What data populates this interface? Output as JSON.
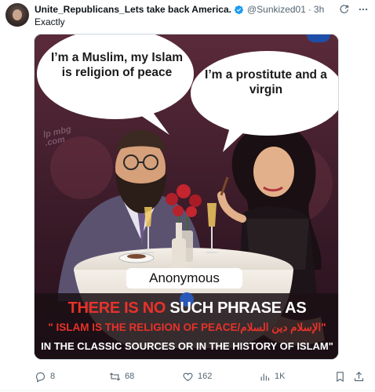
{
  "post": {
    "display_name": "Unite_Republicans_Lets take back America.",
    "handle": "@Sunkized01",
    "separator": "·",
    "time": "3h",
    "text": "Exactly"
  },
  "media": {
    "bubble_left": "I’m a Muslim, my Islam is religion of peace",
    "bubble_right": "I’m a prostitute and a virgin",
    "watermark": "lp mbg .com",
    "label": "Anonymous",
    "caption": {
      "line1_red": "THERE IS NO",
      "line1_white": "SUCH PHRASE AS",
      "line2": "\" ISLAM IS THE RELIGION OF PEACE/الإسلام دين السلام\"",
      "line3": "IN THE CLASSIC SOURCES OR IN THE HISTORY OF ISLAM\""
    }
  },
  "actions": {
    "replies": "8",
    "reposts": "68",
    "likes": "162",
    "views": "1K"
  },
  "icons": {
    "verified": "verified-badge-icon",
    "grok": "grok-icon",
    "more": "more-icon",
    "reply": "reply-icon",
    "repost": "repost-icon",
    "like": "heart-icon",
    "views": "views-icon",
    "bookmark": "bookmark-icon",
    "share": "share-icon"
  },
  "colors": {
    "verified_blue": "#1d9bf0",
    "meta_gray": "#536471",
    "caption_red": "#e8322a"
  }
}
